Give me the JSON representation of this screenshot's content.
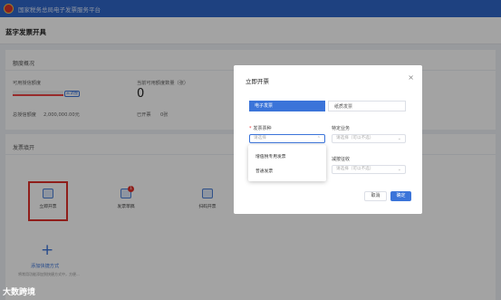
{
  "header": {
    "app_title": "国家税务总局电子发票服务平台"
  },
  "page": {
    "title": "蓝字发票开具"
  },
  "overview": {
    "section_title": "额度概况",
    "available_quota_label": "可用授信额度",
    "quota_tag": "去调整",
    "current_invoices_label": "当前可用额度数量（张）",
    "current_invoices_value": "0",
    "total_quota_label": "总授信额度",
    "total_quota_value": "2,000,000.00元",
    "issued_label": "已开票",
    "issued_value": "0张"
  },
  "services": {
    "section_title": "发票填开",
    "tiles": [
      {
        "label": "立即开票"
      },
      {
        "label": "发票草稿",
        "badge": "1"
      },
      {
        "label": "扫码开票"
      }
    ],
    "add_more": "添加快捷方式",
    "add_hint": "将常用功能添加到快捷方式中，方便..."
  },
  "modal": {
    "title": "立即开票",
    "close": "×",
    "tab_electronic": "电子发票",
    "tab_paper": "纸质发票",
    "field_type_label": "发票票种",
    "field_type_placeholder": "请选择",
    "field_business_label": "特定业务",
    "field_business_placeholder": "请选择（可以不选）",
    "field_tax_label": "减按征收",
    "field_tax_placeholder": "请选择（可以不选）",
    "dropdown_options": [
      "增值税专用发票",
      "普通发票"
    ],
    "cancel": "取消",
    "confirm": "确定"
  },
  "watermark": "大数跨境",
  "colors": {
    "primary": "#3b74d9",
    "header": "#2f66c9",
    "danger": "#e0302a"
  }
}
